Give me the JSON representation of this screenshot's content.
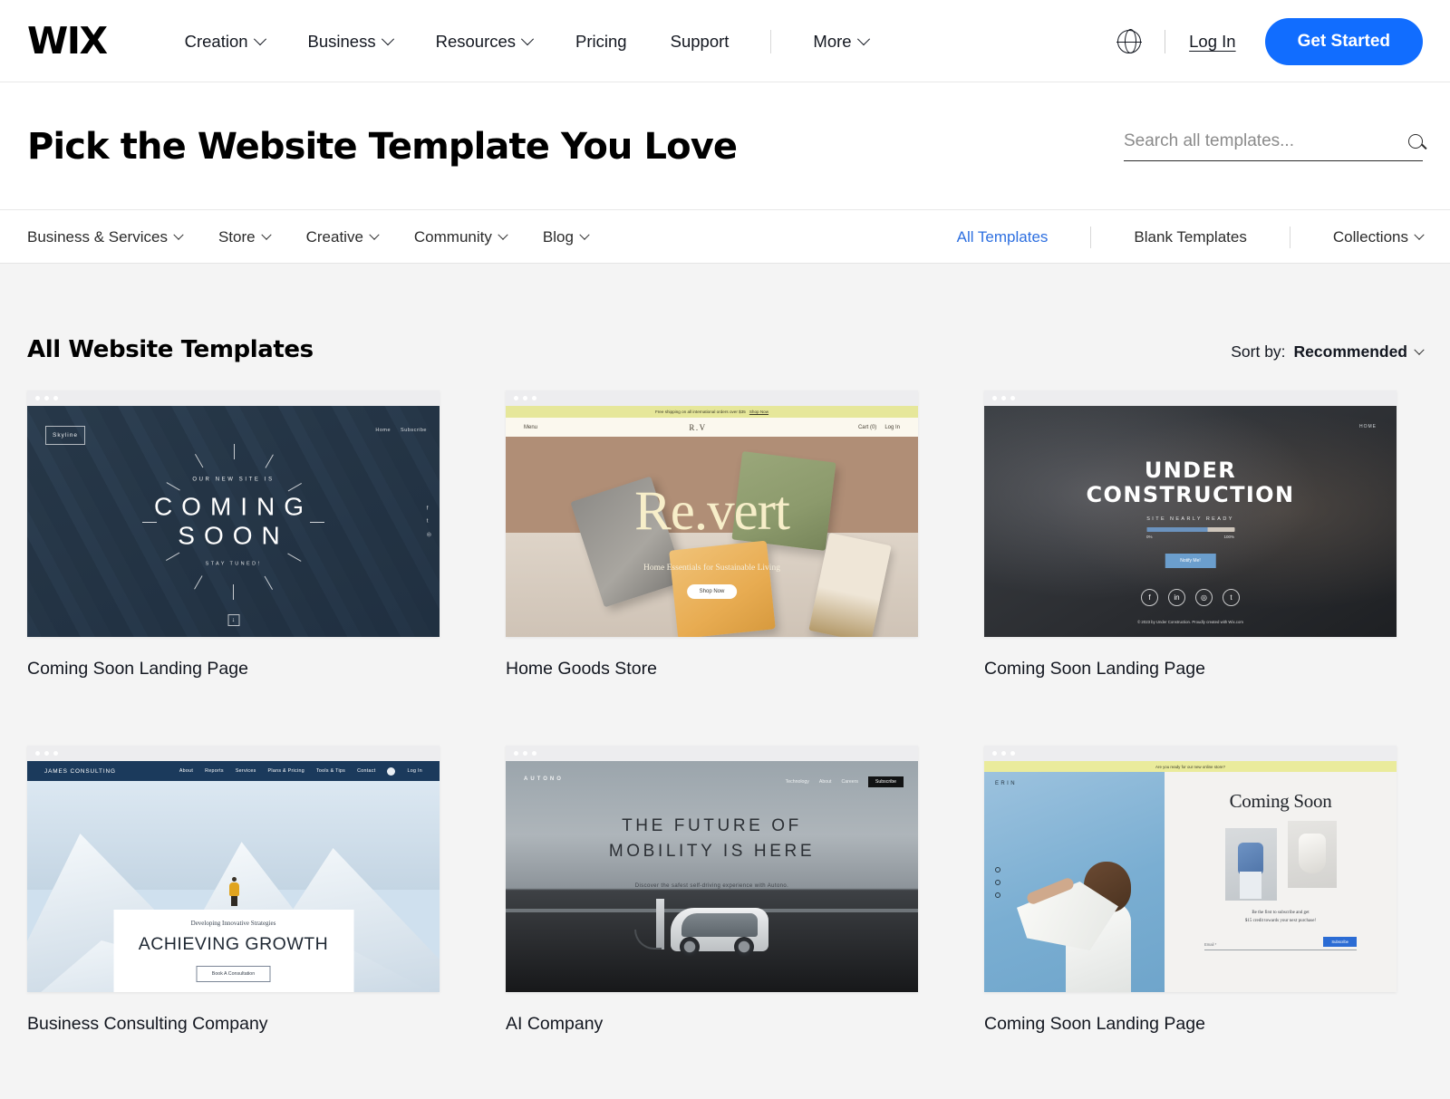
{
  "header": {
    "logo": "WIX",
    "nav": [
      {
        "label": "Creation",
        "has_chevron": true
      },
      {
        "label": "Business",
        "has_chevron": true
      },
      {
        "label": "Resources",
        "has_chevron": true
      },
      {
        "label": "Pricing",
        "has_chevron": false
      },
      {
        "label": "Support",
        "has_chevron": false
      },
      {
        "label": "More",
        "has_chevron": true
      }
    ],
    "language_icon": "globe-icon",
    "login_label": "Log In",
    "cta_label": "Get Started",
    "cta_color": "#116dff"
  },
  "page": {
    "title": "Pick the Website Template You Love",
    "search_placeholder": "Search all templates...",
    "search_value": "",
    "search_icon": "search-icon"
  },
  "categories": {
    "left": [
      {
        "label": "Business & Services",
        "has_chevron": true
      },
      {
        "label": "Store",
        "has_chevron": true
      },
      {
        "label": "Creative",
        "has_chevron": true
      },
      {
        "label": "Community",
        "has_chevron": true
      },
      {
        "label": "Blog",
        "has_chevron": true
      }
    ],
    "right": [
      {
        "label": "All Templates",
        "active": true,
        "has_chevron": false
      },
      {
        "label": "Blank Templates",
        "active": false,
        "has_chevron": false
      },
      {
        "label": "Collections",
        "active": false,
        "has_chevron": true
      }
    ],
    "active_color": "#2d6fe0"
  },
  "section": {
    "heading": "All Website Templates",
    "sort_prefix": "Sort by:",
    "sort_value": "Recommended"
  },
  "templates": [
    {
      "title": "Coming Soon Landing Page",
      "preview": {
        "brand": "Skyline",
        "nav": [
          "Home",
          "Subscribe"
        ],
        "pre_text": "OUR NEW SITE IS",
        "line1": "COMING",
        "line2": "SOON",
        "post_text": "STAY TUNED!",
        "scroll_icon": "down-arrow-icon"
      }
    },
    {
      "title": "Home Goods Store",
      "preview": {
        "promo": "Free shipping on all international orders over $35",
        "promo_link": "Shop Now",
        "menu": "Menu",
        "brand": "R.V",
        "cart": "Cart (0)",
        "login": "Log In",
        "hero_title": "Re.vert",
        "hero_sub": "Home Essentials for Sustainable Living",
        "hero_button": "Shop Now"
      }
    },
    {
      "title": "Coming Soon Landing Page",
      "preview": {
        "nav": "HOME",
        "line1": "UNDER",
        "line2": "CONSTRUCTION",
        "sub": "SITE NEARLY READY",
        "progress_min": "0%",
        "progress_max": "100%",
        "progress_value": 70,
        "button": "Notify Me!",
        "socials": [
          "facebook-icon",
          "linkedin-icon",
          "instagram-icon",
          "twitter-icon"
        ],
        "copyright": "© 2023 by Under Construction. Proudly created with Wix.com"
      }
    },
    {
      "title": "Business Consulting Company",
      "preview": {
        "brand": "JAMES CONSULTING",
        "nav": [
          "About",
          "Reports",
          "Services",
          "Plans & Pricing",
          "Tools & Tips",
          "Contact"
        ],
        "login": "Log In",
        "kicker": "Developing Innovative Strategies",
        "headline": "ACHIEVING GROWTH",
        "button": "Book A Consultation"
      }
    },
    {
      "title": "AI Company",
      "preview": {
        "brand": "AUTONO",
        "nav": [
          "Technology",
          "About",
          "Careers"
        ],
        "cta": "Subscribe",
        "line1": "THE FUTURE OF",
        "line2": "MOBILITY IS HERE",
        "sub": "Discover the safest self-driving experience with Autono."
      }
    },
    {
      "title": "Coming Soon Landing Page",
      "preview": {
        "promo": "Are you ready for our new online store?",
        "brand": "ERIN",
        "heading": "Coming Soon",
        "note_line1": "Be the first to subscribe and get",
        "note_line2": "$15 credit towards your next purchase!",
        "email_label": "Email *",
        "subscribe": "Subscribe"
      }
    }
  ]
}
